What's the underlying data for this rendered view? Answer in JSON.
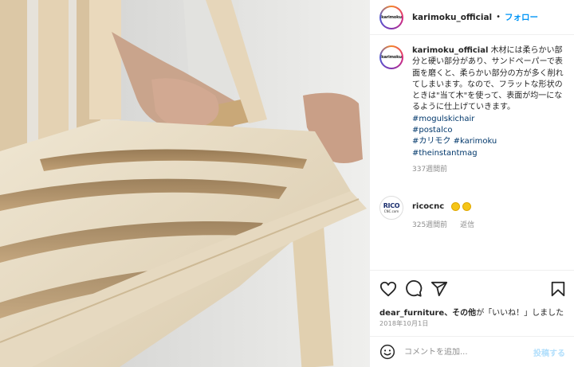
{
  "post": {
    "username": "karimoku_official",
    "avatar_text": "karimoku",
    "separator": "•",
    "follow_label": "フォロー"
  },
  "caption": {
    "username": "karimoku_official",
    "text": "木材には柔らかい部分と硬い部分があり、サンドペーパーで表面を磨くと、柔らかい部分の方が多く削れてしまいます。なので、フラットな形状のときは\"当て木\"を使って、表面が均一になるように仕上げていきます。",
    "hashtags": [
      "#mogulskichair",
      "#postalco"
    ],
    "hashtag_line_a": "#カリモク",
    "hashtag_line_b": "#karimoku",
    "hashtag_last": "#theinstantmag",
    "time_ago": "337週間前"
  },
  "comment": {
    "username": "ricocnc",
    "avatar_text_1": "RICO",
    "avatar_text_2": "CNC.com",
    "emoji": "👏👏",
    "time_ago": "325週間前",
    "reply_label": "返信"
  },
  "actions": {
    "icons": [
      "heart-icon",
      "comment-icon",
      "share-icon",
      "bookmark-icon"
    ]
  },
  "likes": {
    "liker": "dear_furniture",
    "others": "、その他",
    "suffix": "が「いいね！」しました"
  },
  "date": "2018年10月1日",
  "add_comment": {
    "placeholder": "コメントを追加...",
    "post_label": "投稿する"
  },
  "colors": {
    "accent": "#0095f6",
    "link": "#00376b",
    "muted": "#8e8e8e",
    "wood": "#e2d6bf"
  }
}
